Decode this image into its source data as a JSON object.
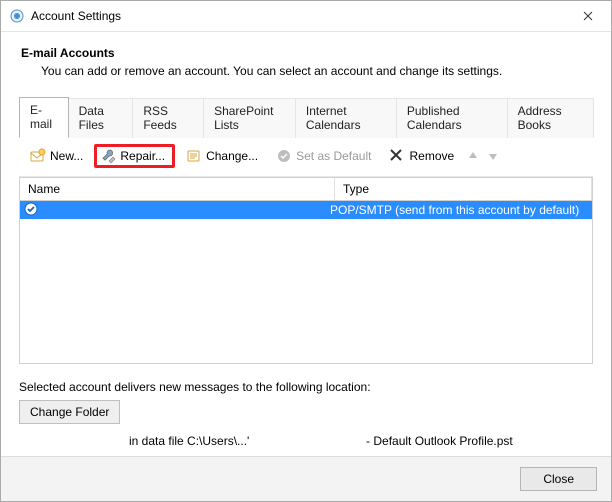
{
  "window": {
    "title": "Account Settings"
  },
  "header": {
    "heading": "E-mail Accounts",
    "description": "You can add or remove an account. You can select an account and change its settings."
  },
  "tabs": [
    {
      "label": "E-mail",
      "active": true
    },
    {
      "label": "Data Files",
      "active": false
    },
    {
      "label": "RSS Feeds",
      "active": false
    },
    {
      "label": "SharePoint Lists",
      "active": false
    },
    {
      "label": "Internet Calendars",
      "active": false
    },
    {
      "label": "Published Calendars",
      "active": false
    },
    {
      "label": "Address Books",
      "active": false
    }
  ],
  "toolbar": {
    "new": "New...",
    "repair": "Repair...",
    "change": "Change...",
    "set_default": "Set as Default",
    "remove": "Remove"
  },
  "columns": {
    "name": "Name",
    "type": "Type"
  },
  "accounts": [
    {
      "name": "",
      "type": "POP/SMTP (send from this account by default)",
      "default": true
    }
  ],
  "delivery": {
    "label": "Selected account delivers new messages to the following location:",
    "change_folder": "Change Folder",
    "path_prefix": "in data file C:\\Users\\...'",
    "profile": "- Default Outlook Profile.pst"
  },
  "footer": {
    "close": "Close"
  }
}
